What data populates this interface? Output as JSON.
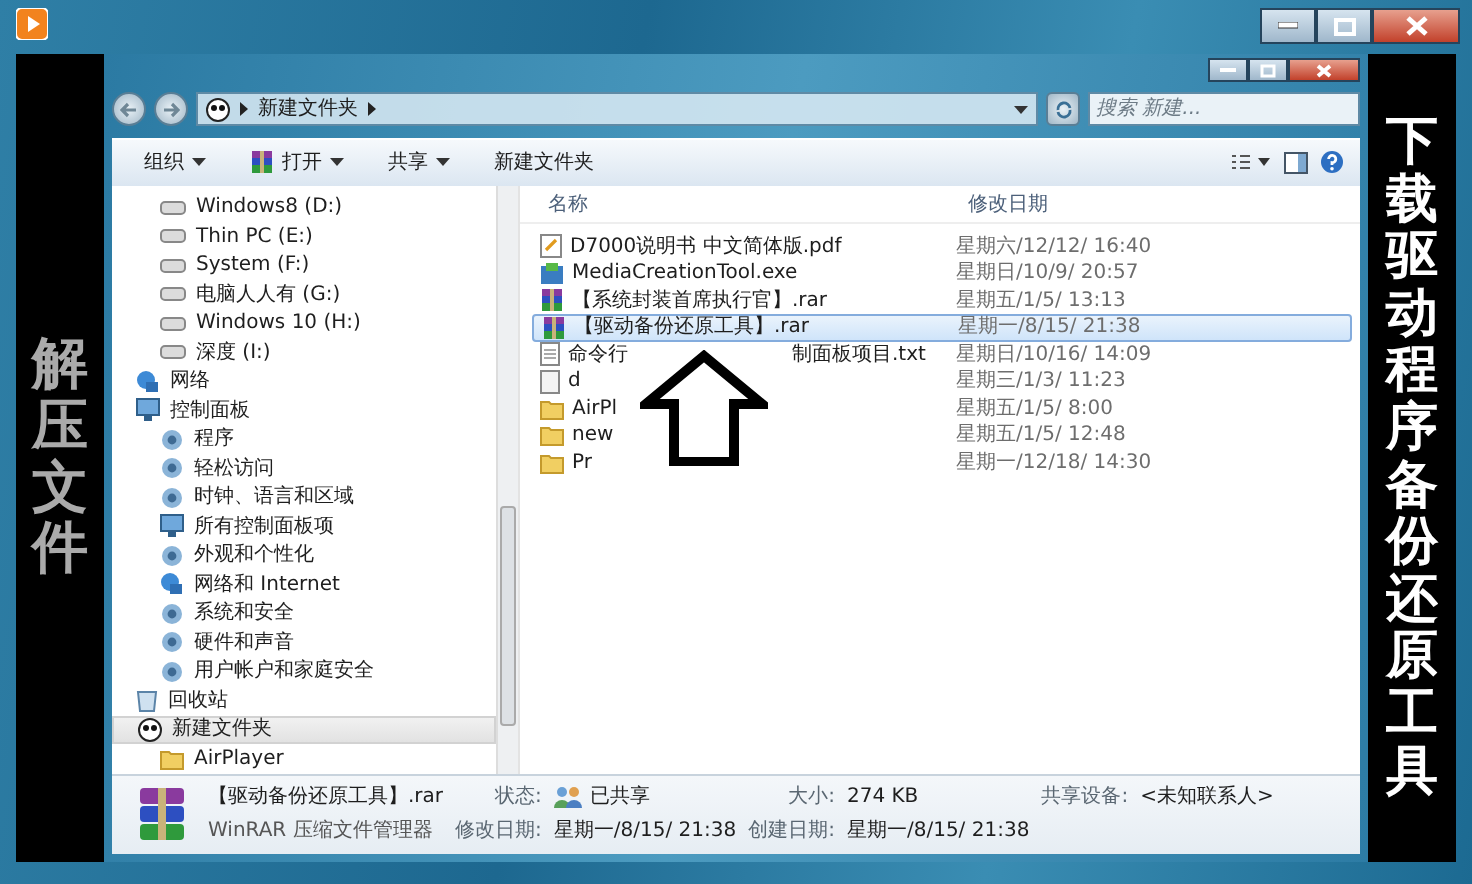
{
  "left_caption": "解压文件",
  "right_caption": "下载驱动程序备份还原工具",
  "explorer": {
    "address": {
      "path": [
        "新建文件夹"
      ]
    },
    "search": {
      "placeholder": "搜索 新建..."
    },
    "toolbar": [
      {
        "label": "组织",
        "dropdown": true,
        "kind": "plain"
      },
      {
        "label": "打开",
        "dropdown": true,
        "kind": "rar"
      },
      {
        "label": "共享",
        "dropdown": true,
        "kind": "plain"
      },
      {
        "label": "新建文件夹",
        "dropdown": false,
        "kind": "plain"
      }
    ],
    "sidebar": {
      "drives": [
        {
          "label": "Windows8 (D:)",
          "kind": "drive"
        },
        {
          "label": "Thin PC (E:)",
          "kind": "drive"
        },
        {
          "label": "System (F:)",
          "kind": "drive"
        },
        {
          "label": "电脑人人有 (G:)",
          "kind": "drive"
        },
        {
          "label": "Windows 10 (H:)",
          "kind": "drive"
        },
        {
          "label": "深度 (I:)",
          "kind": "drive"
        }
      ],
      "tree": [
        {
          "label": "网络",
          "kind": "network",
          "selected": false
        },
        {
          "label": "控制面板",
          "kind": "panel",
          "selected": false,
          "children": [
            {
              "label": "程序",
              "kind": "setting",
              "selected": false
            },
            {
              "label": "轻松访问",
              "kind": "setting",
              "selected": false
            },
            {
              "label": "时钟、语言和区域",
              "kind": "setting",
              "selected": false
            },
            {
              "label": "所有控制面板项",
              "kind": "panel",
              "selected": false
            },
            {
              "label": "外观和个性化",
              "kind": "setting",
              "selected": false
            },
            {
              "label": "网络和 Internet",
              "kind": "network",
              "selected": false
            },
            {
              "label": "系统和安全",
              "kind": "setting",
              "selected": false
            },
            {
              "label": "硬件和声音",
              "kind": "setting",
              "selected": false
            },
            {
              "label": "用户帐户和家庭安全",
              "kind": "setting",
              "selected": false
            }
          ]
        },
        {
          "label": "回收站",
          "kind": "trash",
          "selected": false
        },
        {
          "label": "新建文件夹",
          "kind": "special",
          "selected": true,
          "children": [
            {
              "label": "AirPlayer",
              "kind": "folder",
              "selected": false
            }
          ]
        }
      ]
    },
    "file_list": {
      "columns": [
        "名称",
        "修改日期"
      ],
      "rows": [
        {
          "name_parts": [
            "D7000说明书 中文简体版.pdf"
          ],
          "date": "星期六/12/12/ 16:40",
          "kind": "pdf",
          "selected": false
        },
        {
          "name_parts": [
            "MediaCreationTool.exe"
          ],
          "date": "星期日/10/9/ 20:57",
          "kind": "exe",
          "selected": false
        },
        {
          "name_parts": [
            "【系统封装首席执行官】.rar"
          ],
          "date": "星期五/1/5/ 13:13",
          "kind": "rar",
          "selected": false
        },
        {
          "name_parts": [
            "【驱动备份还原工具】.rar"
          ],
          "date": "星期一/8/15/ 21:38",
          "kind": "rar",
          "selected": true
        },
        {
          "name_parts": [
            "命令行",
            "制面板项目.txt"
          ],
          "date": "星期日/10/16/ 14:09",
          "kind": "txt",
          "selected": false
        },
        {
          "name_parts": [
            "d"
          ],
          "date": "星期三/1/3/ 11:23",
          "kind": "file",
          "selected": false
        },
        {
          "name_parts": [
            "AirPl"
          ],
          "date": "星期五/1/5/ 8:00",
          "kind": "folder",
          "selected": false
        },
        {
          "name_parts": [
            "new"
          ],
          "date": "星期五/1/5/ 12:48",
          "kind": "folder",
          "selected": false
        },
        {
          "name_parts": [
            "Pr"
          ],
          "date": "星期一/12/18/ 14:30",
          "kind": "folder",
          "selected": false
        }
      ]
    },
    "details": {
      "name": "【驱动备份还原工具】.rar",
      "type": "WinRAR 压缩文件管理器",
      "fields": [
        {
          "label": "状态:",
          "value": "已共享",
          "kind": "shared"
        },
        {
          "label": "大小:",
          "value": "274 KB",
          "kind": "plain"
        },
        {
          "label": "共享设备:",
          "value": "<未知联系人>",
          "kind": "plain"
        },
        {
          "label": "修改日期:",
          "value": "星期一/8/15/ 21:38",
          "kind": "plain"
        },
        {
          "label": "创建日期:",
          "value": "星期一/8/15/ 21:38",
          "kind": "plain"
        }
      ]
    }
  }
}
